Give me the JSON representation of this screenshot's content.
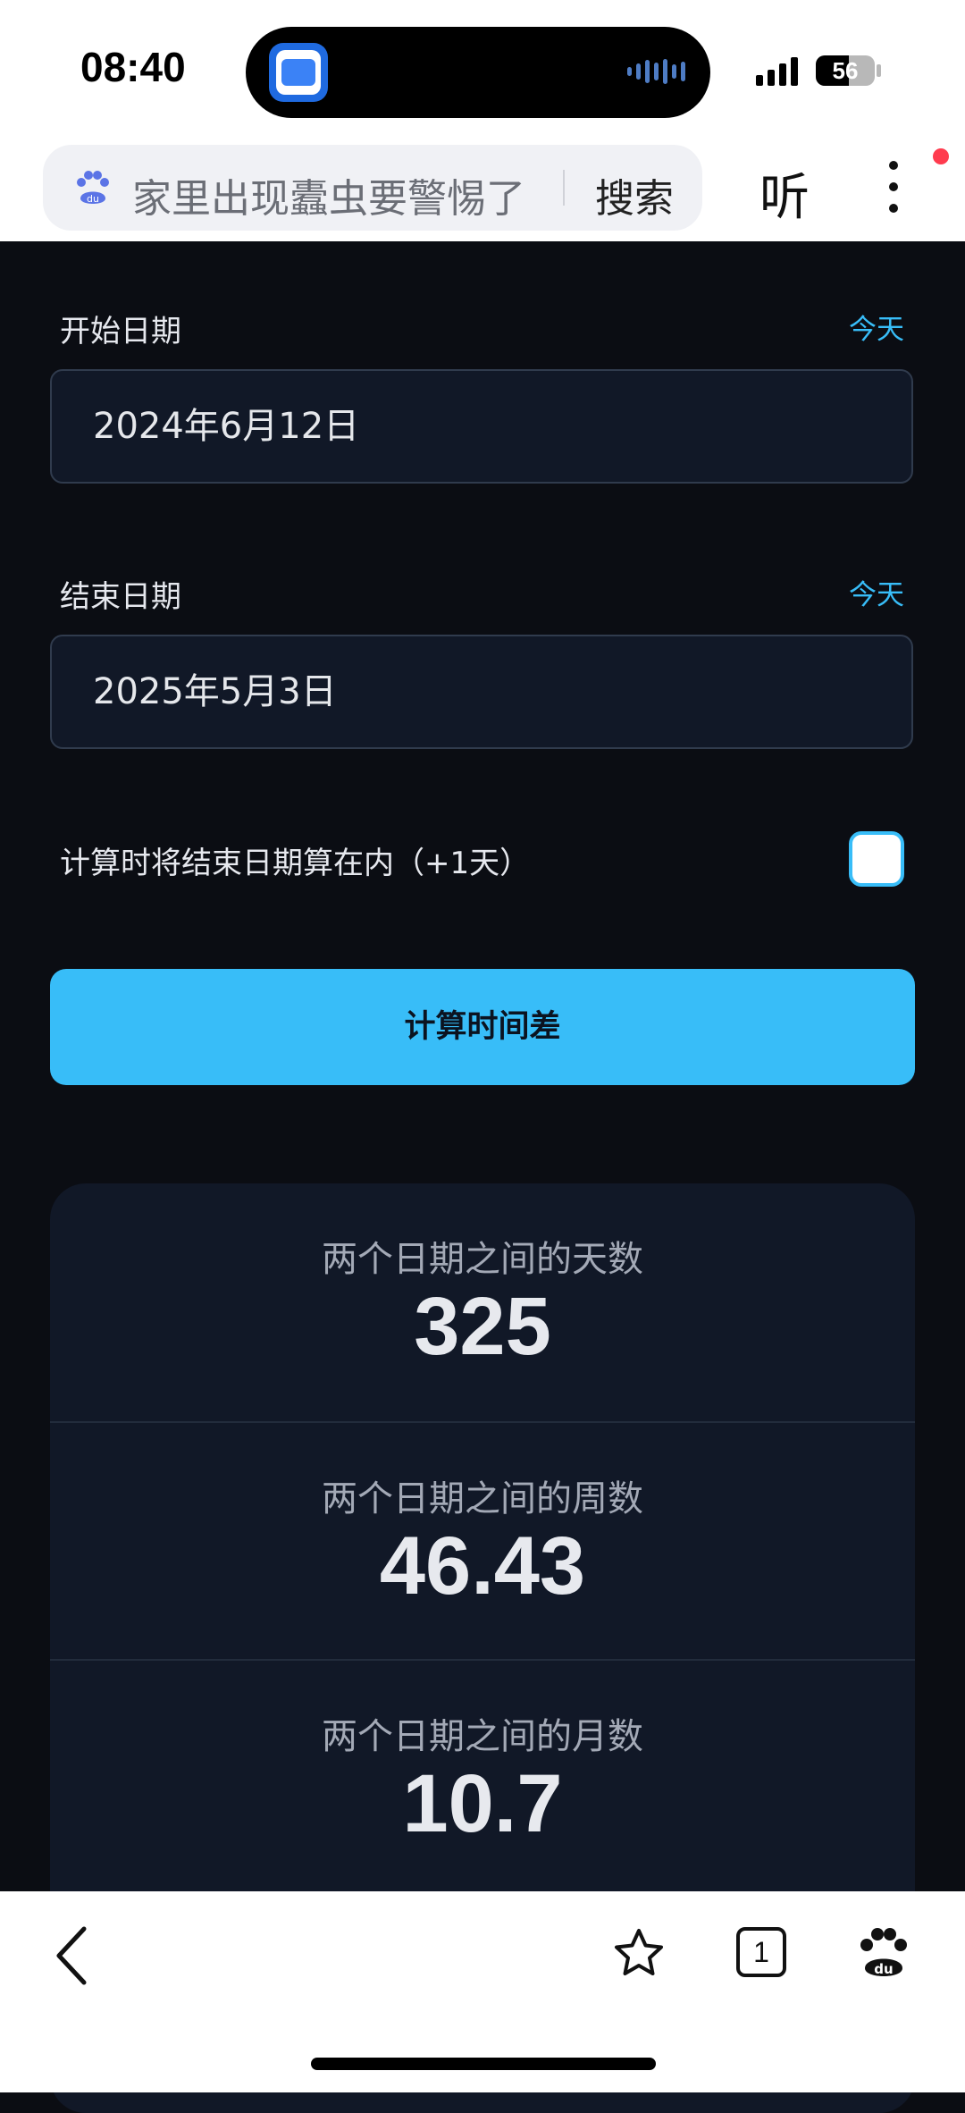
{
  "status_bar": {
    "time": "08:40",
    "battery": "56",
    "battery_level": 0.56
  },
  "browser": {
    "search_text": "家里出现蠹虫要警惕了",
    "search_button": "搜索",
    "listen_label": "听",
    "tab_count": "1"
  },
  "form": {
    "start_label": "开始日期",
    "start_today": "今天",
    "start_value": "2024年6月12日",
    "end_label": "结束日期",
    "end_today": "今天",
    "end_value": "2025年5月3日",
    "include_end_label": "计算时将结束日期算在内（+1天）",
    "include_end_checked": false,
    "calculate_button": "计算时间差"
  },
  "results": [
    {
      "label": "两个日期之间的天数",
      "value": "325"
    },
    {
      "label": "两个日期之间的周数",
      "value": "46.43"
    },
    {
      "label": "两个日期之间的月数",
      "value": "10.7"
    }
  ],
  "colors": {
    "accent": "#38bdf8",
    "page_background": "#0b0d13",
    "card_background": "#111827"
  }
}
